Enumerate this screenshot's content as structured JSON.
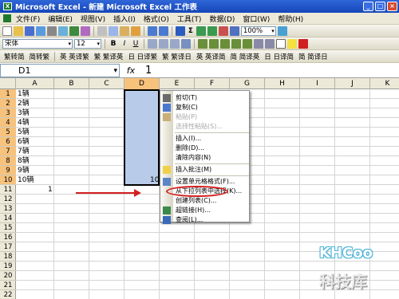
{
  "window": {
    "title": "Microsoft Excel - 新建 Microsoft Excel 工作表",
    "app_icon": "X"
  },
  "menubar": {
    "items": [
      "文件(F)",
      "编辑(E)",
      "视图(V)",
      "插入(I)",
      "格式(O)",
      "工具(T)",
      "数据(D)",
      "窗口(W)",
      "帮助(H)"
    ]
  },
  "toolbar_standard": {
    "zoom": "100%",
    "sum_symbol": "Σ"
  },
  "toolbar_format": {
    "font": "宋体",
    "size": "12",
    "bold": "B",
    "italic": "I",
    "underline": "U"
  },
  "toolbar_translate": {
    "items": [
      "繁转简",
      "简转繁",
      "英 英译繁",
      "繁 繁译英",
      "日 日译繁",
      "繁 繁译日",
      "英 英译简",
      "简 简译英",
      "日 日译简",
      "简 简译日"
    ]
  },
  "formula": {
    "name_box": "D1",
    "fx": "fx",
    "value": "1"
  },
  "grid": {
    "columns": [
      "A",
      "B",
      "C",
      "D",
      "E",
      "F",
      "G",
      "H",
      "I",
      "J",
      "K"
    ],
    "selected_column": "D",
    "rows": [
      "1",
      "2",
      "3",
      "4",
      "5",
      "6",
      "7",
      "8",
      "9",
      "10",
      "11",
      "12",
      "13",
      "14",
      "15",
      "16",
      "17",
      "18",
      "19",
      "20",
      "21",
      "22"
    ],
    "selected_rows": [
      "1",
      "2",
      "3",
      "4",
      "5",
      "6",
      "7",
      "8",
      "9",
      "10"
    ],
    "col_a_values": [
      "1辆",
      "2辆",
      "3辆",
      "4辆",
      "5辆",
      "6辆",
      "7辆",
      "8辆",
      "9辆",
      "10辆"
    ],
    "a11_value": "1",
    "d10_value": "10"
  },
  "context_menu": {
    "items": [
      {
        "label": "剪切(T)",
        "icon": "scissors-icon",
        "enabled": true
      },
      {
        "label": "复制(C)",
        "icon": "copy-icon",
        "enabled": true
      },
      {
        "label": "粘贴(P)",
        "icon": "paste-icon",
        "enabled": false
      },
      {
        "label": "选择性粘贴(S)...",
        "icon": "",
        "enabled": false
      },
      {
        "label": "插入(I)...",
        "icon": "",
        "enabled": true
      },
      {
        "label": "删除(D)...",
        "icon": "",
        "enabled": true
      },
      {
        "label": "清除内容(N)",
        "icon": "",
        "enabled": true
      },
      {
        "label": "插入批注(M)",
        "icon": "comment-icon",
        "enabled": true
      },
      {
        "label": "设置单元格格式(F)...",
        "icon": "format-cells-icon",
        "enabled": true
      },
      {
        "label": "从下拉列表中选择(K)...",
        "icon": "",
        "enabled": true
      },
      {
        "label": "创建列表(C)...",
        "icon": "",
        "enabled": true
      },
      {
        "label": "超链接(H)...",
        "icon": "hyperlink-icon",
        "enabled": true
      },
      {
        "label": "查阅(L)...",
        "icon": "lookup-icon",
        "enabled": true
      }
    ]
  },
  "watermark": {
    "logo": "KHCoo",
    "text": "科技库"
  },
  "colors": {
    "title_bar": "#1546b8",
    "selection": "#b8cbe8",
    "header_selected": "#f7c27c",
    "annotation": "#d42020"
  }
}
